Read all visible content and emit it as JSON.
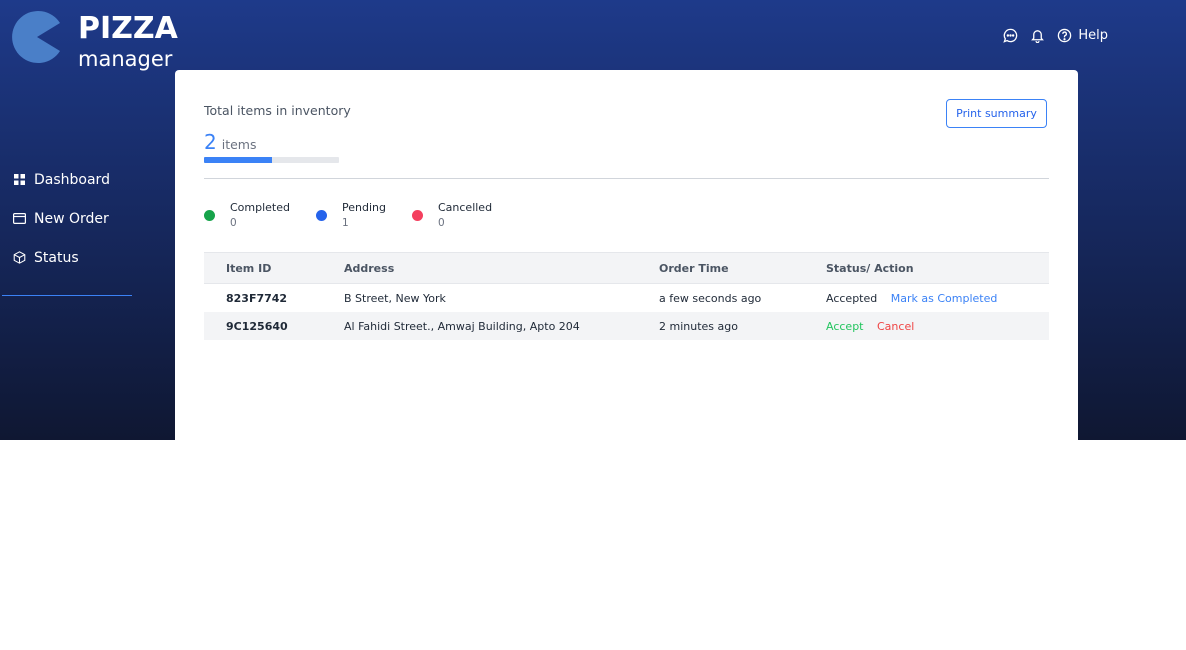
{
  "brand": {
    "line1": "PIZZA",
    "line2": "manager",
    "color": "#4a7fc8"
  },
  "topnav": {
    "chat_icon": "chat-icon",
    "bell_icon": "bell-icon",
    "help_icon": "help-circle-icon",
    "help_label": "Help"
  },
  "sidebar": {
    "items": [
      {
        "label": "Dashboard",
        "icon": "grid-icon"
      },
      {
        "label": "New Order",
        "icon": "card-icon"
      },
      {
        "label": "Status",
        "icon": "box-icon"
      }
    ]
  },
  "inventory": {
    "title": "Total items in inventory",
    "count": "2",
    "unit": "items",
    "progress": 0.5,
    "print_label": "Print summary"
  },
  "legend": [
    {
      "label": "Completed",
      "value": "0",
      "color": "#16a34a"
    },
    {
      "label": "Pending",
      "value": "1",
      "color": "#2563eb"
    },
    {
      "label": "Cancelled",
      "value": "0",
      "color": "#f43f5e"
    }
  ],
  "table": {
    "headers": [
      "Item ID",
      "Address",
      "Order Time",
      "Status/ Action"
    ],
    "rows": [
      {
        "id": "823F7742",
        "address": "B Street, New York",
        "time": "a few seconds ago",
        "status": "Accepted",
        "action": "Mark as Completed"
      },
      {
        "id": "9C125640",
        "address": "Al Fahidi Street., Amwaj Building, Apto 204",
        "time": "2 minutes ago",
        "accept": "Accept",
        "cancel": "Cancel"
      }
    ]
  }
}
